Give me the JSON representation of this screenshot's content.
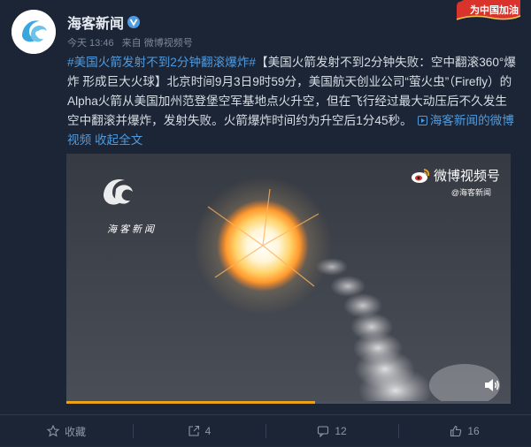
{
  "account": {
    "name": "海客新闻",
    "time": "今天 13:46",
    "source": "来自 微博视频号"
  },
  "corner_badge": "为中国加油",
  "post": {
    "tag": "#美国火箭发射不到2分钟翻滚爆炸#",
    "text": "【美国火箭发射不到2分钟失败：空中翻滚360°爆炸 形成巨大火球】北京时间9月3日9时59分，美国航天创业公司“萤火虫”（Firefly）的Alpha火箭从美国加州范登堡空军基地点火升空，但在飞行经过最大动压后不久发生空中翻滚并爆炸，发射失败。火箭爆炸时间约为升空后1分45秒。",
    "video_link": "海客新闻的微博视频",
    "expand": "收起全文"
  },
  "video": {
    "watermark_logo_text": "海客新闻",
    "platform_label": "微博视频号",
    "platform_sub": "@海客新闻",
    "progress": 0.56
  },
  "actions": [
    {
      "icon": "star-icon",
      "label": "收藏"
    },
    {
      "icon": "share-icon",
      "label": "4"
    },
    {
      "icon": "comment-icon",
      "label": "12"
    },
    {
      "icon": "like-icon",
      "label": "16"
    }
  ],
  "colors": {
    "background": "#1b2535",
    "link": "#4f9be0",
    "progress": "#e8a317"
  }
}
